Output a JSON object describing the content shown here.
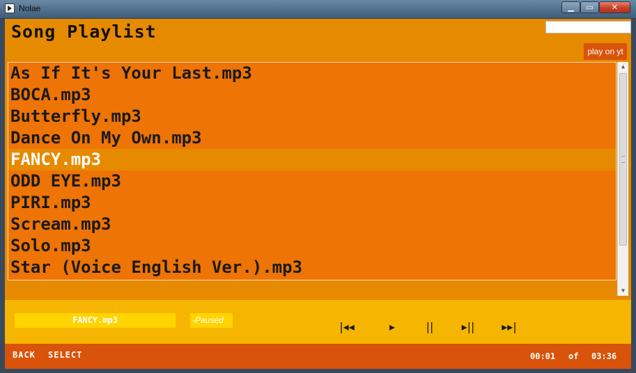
{
  "window": {
    "title": "Nolae"
  },
  "header": {
    "title": "Song Playlist",
    "search_value": "",
    "play_yt_label": "play on yt"
  },
  "playlist": {
    "items": [
      "As If It's Your Last.mp3",
      "BOCA.mp3",
      "Butterfly.mp3",
      "Dance On My Own.mp3",
      "FANCY.mp3",
      "ODD EYE.mp3",
      "PIRI.mp3",
      "Scream.mp3",
      "Solo.mp3",
      "Star (Voice English Ver.).mp3"
    ],
    "selected_index": 4
  },
  "player": {
    "now_playing": "FANCY.mp3",
    "status": "-Paused",
    "controls": {
      "prev": "|◂◂",
      "play": "▸",
      "pause": "||",
      "step": "▸||",
      "next": "▸▸|"
    }
  },
  "footer": {
    "back_label": "BACK",
    "select_label": "SELECT",
    "current_time": "00:01",
    "of_label": "of",
    "total_time": "03:36"
  },
  "colors": {
    "primary": "#e68a00",
    "list_bg": "#ee7405",
    "player_bg": "#f5b500",
    "footer_bg": "#d9530a",
    "highlight": "#ffd400"
  }
}
